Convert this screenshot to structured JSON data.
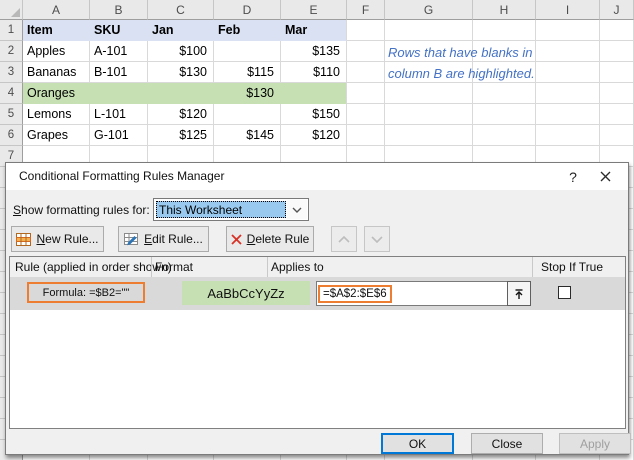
{
  "spreadsheet": {
    "column_headers": [
      "A",
      "B",
      "C",
      "D",
      "E",
      "F",
      "G",
      "H",
      "I",
      "J"
    ],
    "visible_row_numbers": [
      1,
      2,
      3,
      4,
      5,
      6,
      7
    ],
    "header_row": [
      "Item",
      "SKU",
      "Jan",
      "Feb",
      "Mar"
    ],
    "data_rows": [
      {
        "number": 2,
        "cells": [
          "Apples",
          "A-101",
          "$100",
          "",
          "$135"
        ],
        "highlighted": false
      },
      {
        "number": 3,
        "cells": [
          "Bananas",
          "B-101",
          "$130",
          "$115",
          "$110"
        ],
        "highlighted": false
      },
      {
        "number": 4,
        "cells": [
          "Oranges",
          "",
          "",
          "$130",
          ""
        ],
        "highlighted": true
      },
      {
        "number": 5,
        "cells": [
          "Lemons",
          "L-101",
          "$120",
          "",
          "$150"
        ],
        "highlighted": false
      },
      {
        "number": 6,
        "cells": [
          "Grapes",
          "G-101",
          "$125",
          "$145",
          "$120"
        ],
        "highlighted": false
      }
    ],
    "note_lines": [
      "Rows that have blanks in",
      "column B are highlighted."
    ],
    "colors": {
      "header_fill": "#d9e1f2",
      "highlight_fill": "#c6e0b4",
      "note_text": "#4472c4"
    }
  },
  "dialog": {
    "title": "Conditional Formatting Rules Manager",
    "help_glyph": "?",
    "scope_label": "Show formatting rules for:",
    "scope_value": "This Worksheet",
    "toolbar": {
      "new_rule_label": "New Rule...",
      "edit_rule_label": "Edit Rule...",
      "delete_rule_label": "Delete Rule"
    },
    "rules_table": {
      "headers": {
        "rule": "Rule (applied in order shown)",
        "format": "Format",
        "applies_to": "Applies to",
        "stop_if_true": "Stop If True"
      },
      "rules": [
        {
          "rule": "Formula: =$B2=\"\"",
          "format_preview": "AaBbCcYyZz",
          "applies_to": "=$A$2:$E$6",
          "stop_if_true": false
        }
      ]
    },
    "footer": {
      "ok_label": "OK",
      "close_label": "Close",
      "apply_label": "Apply",
      "apply_enabled": false
    },
    "colors": {
      "accent_orange": "#ed7d31",
      "selection_blue": "#99c9ef",
      "focus_blue": "#0078d7",
      "preview_fill": "#c6e0b4"
    }
  }
}
